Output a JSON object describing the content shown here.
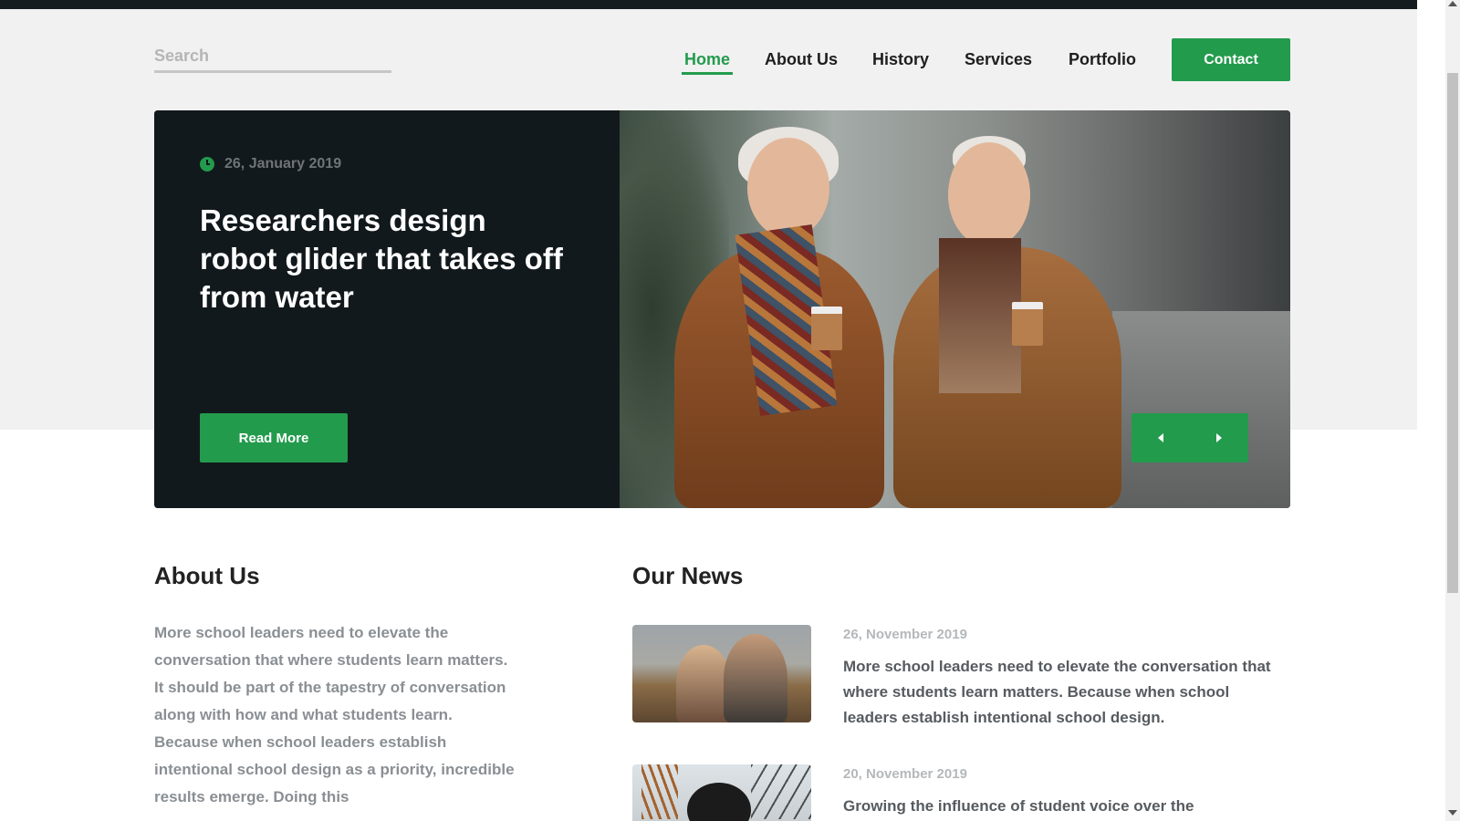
{
  "header": {
    "search_placeholder": "Search",
    "nav": [
      "Home",
      "About Us",
      "History",
      "Services",
      "Portfolio"
    ],
    "active_nav": "Home",
    "contact_label": "Contact"
  },
  "hero": {
    "date": "26, January 2019",
    "title": "Researchers design robot glider that takes off from water",
    "read_more_label": "Read More"
  },
  "about": {
    "title": "About Us",
    "text": "More school leaders need to elevate the conversation that where students learn matters. It should be part of the tapestry of conversation along with how and what students learn. Because when school leaders establish intentional school design as a priority, incredible results emerge. Doing this"
  },
  "news": {
    "title": "Our News",
    "items": [
      {
        "date": "26, November 2019",
        "text": "More school leaders need to elevate the conversation that where students learn matters. Because when school leaders establish intentional school design."
      },
      {
        "date": "20, November 2019",
        "text": "Growing the influence of student voice over the"
      }
    ]
  },
  "colors": {
    "accent": "#239b4d",
    "dark": "#12191c",
    "band": "#f1f1f1"
  },
  "icons": [
    "clock-icon",
    "arrow-left-icon",
    "arrow-right-icon"
  ]
}
